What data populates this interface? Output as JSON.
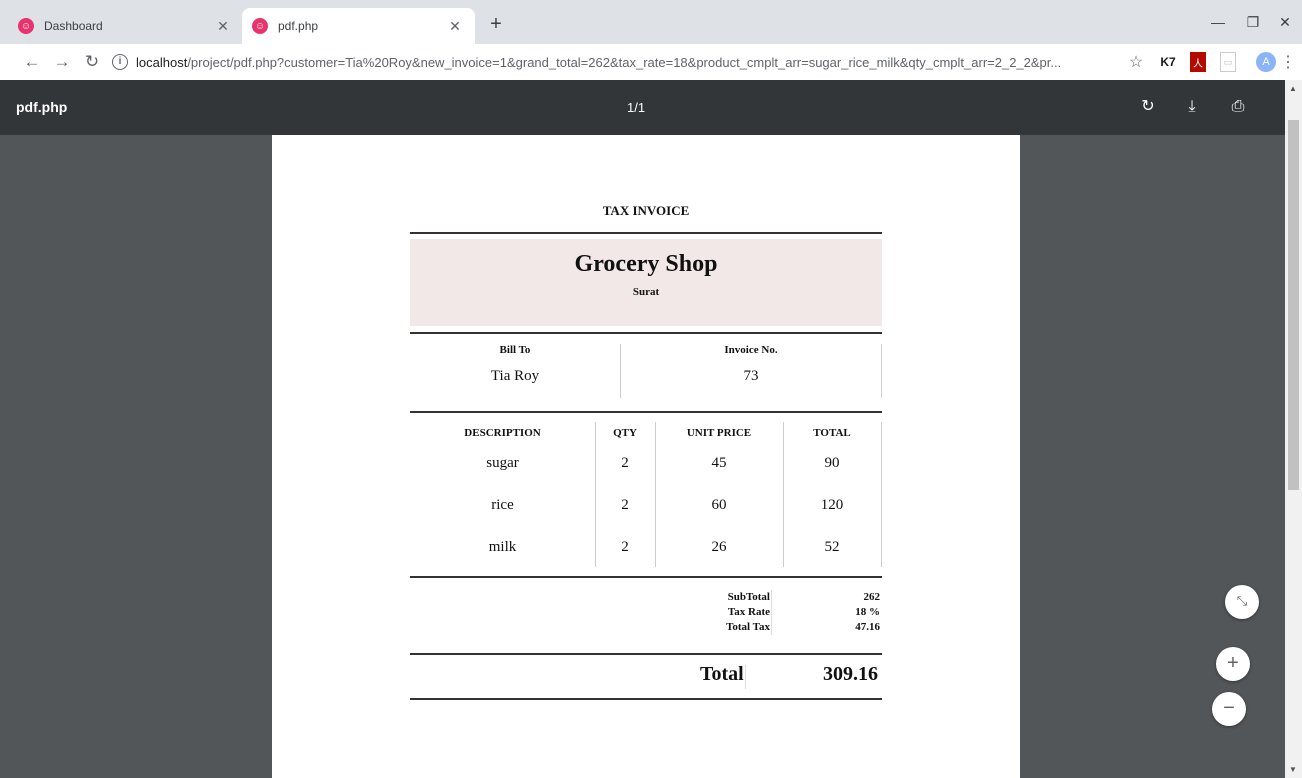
{
  "browser": {
    "tabs": [
      {
        "title": "Dashboard",
        "active": false
      },
      {
        "title": "pdf.php",
        "active": true
      }
    ],
    "new_tab": "+",
    "url_host": "localhost",
    "url_rest": "/project/pdf.php?customer=Tia%20Roy&new_invoice=1&grand_total=262&tax_rate=18&product_cmplt_arr=sugar_rice_milk&qty_cmplt_arr=2_2_2&pr...",
    "profile_initial": "A"
  },
  "viewer": {
    "filename": "pdf.php",
    "page_indicator": "1/1"
  },
  "invoice": {
    "heading": "TAX INVOICE",
    "shop_name": "Grocery Shop",
    "shop_city": "Surat",
    "bill_to_label": "Bill To",
    "bill_to_value": "Tia Roy",
    "invoice_no_label": "Invoice No.",
    "invoice_no_value": "73",
    "columns": [
      "DESCRIPTION",
      "QTY",
      "UNIT PRICE",
      "TOTAL"
    ],
    "rows": [
      {
        "description": "sugar",
        "qty": "2",
        "unit_price": "45",
        "total": "90"
      },
      {
        "description": "rice",
        "qty": "2",
        "unit_price": "60",
        "total": "120"
      },
      {
        "description": "milk",
        "qty": "2",
        "unit_price": "26",
        "total": "52"
      }
    ],
    "subtotal_label": "SubTotal",
    "subtotal_value": "262",
    "tax_rate_label": "Tax Rate",
    "tax_rate_value": "18 %",
    "total_tax_label": "Total Tax",
    "total_tax_value": "47.16",
    "total_label": "Total",
    "total_value": "309.16"
  }
}
